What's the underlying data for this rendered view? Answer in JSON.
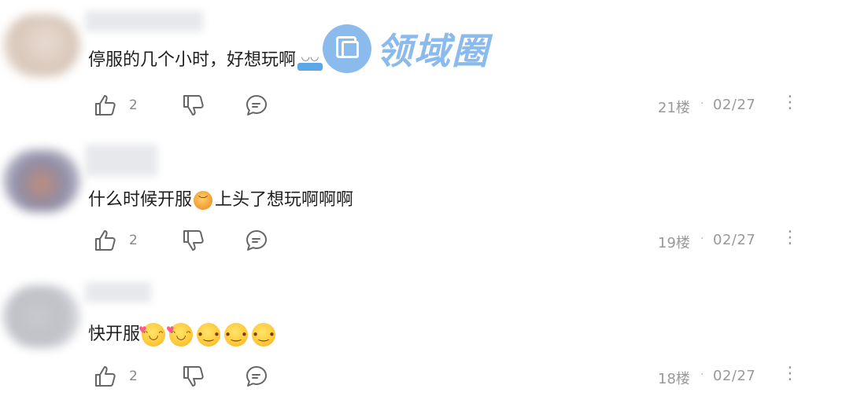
{
  "watermark": {
    "text": "领域圈",
    "color": "#6fa9e8"
  },
  "comments": [
    {
      "text": "停服的几个小时，好想玩啊",
      "emojis": [
        "blue-laptop-emoji"
      ],
      "likes": "2",
      "floor": "21楼",
      "date": "02/27",
      "more": "⋮"
    },
    {
      "text_before": "什么时候开服",
      "text_after": "上头了想玩啊啊啊",
      "emojis": [
        "sad-face-emoji"
      ],
      "likes": "2",
      "floor": "19楼",
      "date": "02/27",
      "more": "⋮"
    },
    {
      "text": "快开服",
      "emojis": [
        "heart-eyes-face-emoji",
        "heart-eyes-face-emoji",
        "wink-face-emoji",
        "wink-face-emoji",
        "wink-face-emoji"
      ],
      "likes": "2",
      "floor": "18楼",
      "date": "02/27",
      "more": "⋮"
    }
  ],
  "separator": "·"
}
